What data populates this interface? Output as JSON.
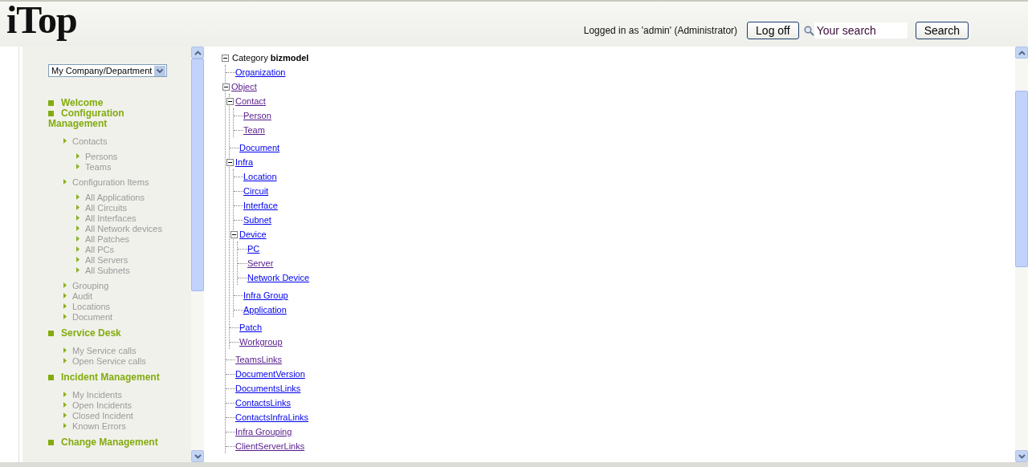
{
  "header": {
    "logo": "iTop",
    "user_info": "Logged in as 'admin' (Administrator)",
    "logoff_button": "Log off",
    "search": {
      "placeholder": "Your search"
    },
    "search_button": "Search"
  },
  "sidebar": {
    "org_select": "My Company/Department",
    "menu": [
      {
        "title": "Welcome"
      },
      {
        "title": "Configuration Management",
        "items": [
          {
            "label": "Contacts",
            "children": [
              {
                "label": "Persons"
              },
              {
                "label": "Teams"
              }
            ]
          },
          {
            "label": "Configuration Items",
            "children": [
              {
                "label": "All Applications"
              },
              {
                "label": "All Circuits"
              },
              {
                "label": "All Interfaces"
              },
              {
                "label": "All Network devices"
              },
              {
                "label": "All Patches"
              },
              {
                "label": "All PCs"
              },
              {
                "label": "All Servers"
              },
              {
                "label": "All Subnets"
              }
            ]
          },
          {
            "label": "Grouping"
          },
          {
            "label": "Audit"
          },
          {
            "label": "Locations"
          },
          {
            "label": "Document"
          }
        ]
      },
      {
        "title": "Service Desk",
        "items": [
          {
            "label": "My Service calls"
          },
          {
            "label": "Open Service calls"
          }
        ]
      },
      {
        "title": "Incident Management",
        "items": [
          {
            "label": "My Incidents"
          },
          {
            "label": "Open Incidents"
          },
          {
            "label": "Closed Incident"
          },
          {
            "label": "Known Errors"
          }
        ]
      },
      {
        "title": "Change Management"
      }
    ]
  },
  "tree": {
    "label": "Category **bizmodel**",
    "expanded": true,
    "children": [
      {
        "label": "Organization",
        "visited": false
      },
      {
        "label": "Object",
        "visited": true,
        "expanded": true,
        "children": [
          {
            "label": "Contact",
            "visited": true,
            "expanded": true,
            "children": [
              {
                "label": "Person",
                "visited": true
              },
              {
                "label": "Team",
                "visited": true
              }
            ]
          },
          {
            "label": "Document",
            "visited": false
          },
          {
            "label": "Infra",
            "visited": false,
            "expanded": true,
            "children": [
              {
                "label": "Location",
                "visited": false
              },
              {
                "label": "Circuit",
                "visited": false
              },
              {
                "label": "Interface",
                "visited": false
              },
              {
                "label": "Subnet",
                "visited": false
              },
              {
                "label": "Device",
                "visited": false,
                "expanded": true,
                "children": [
                  {
                    "label": "PC",
                    "visited": false
                  },
                  {
                    "label": "Server",
                    "visited": true
                  },
                  {
                    "label": "Network Device",
                    "visited": false
                  }
                ]
              },
              {
                "label": "Infra Group",
                "visited": false
              },
              {
                "label": "Application",
                "visited": false
              }
            ]
          },
          {
            "label": "Patch",
            "visited": false
          },
          {
            "label": "Workgroup",
            "visited": true
          }
        ]
      },
      {
        "label": "TeamsLinks",
        "visited": true
      },
      {
        "label": "DocumentVersion",
        "visited": false
      },
      {
        "label": "DocumentsLinks",
        "visited": false
      },
      {
        "label": "ContactsLinks",
        "visited": false
      },
      {
        "label": "ContactsInfraLinks",
        "visited": false
      },
      {
        "label": "Infra Grouping",
        "visited": true
      },
      {
        "label": "ClientServerLinks",
        "visited": true
      }
    ]
  }
}
